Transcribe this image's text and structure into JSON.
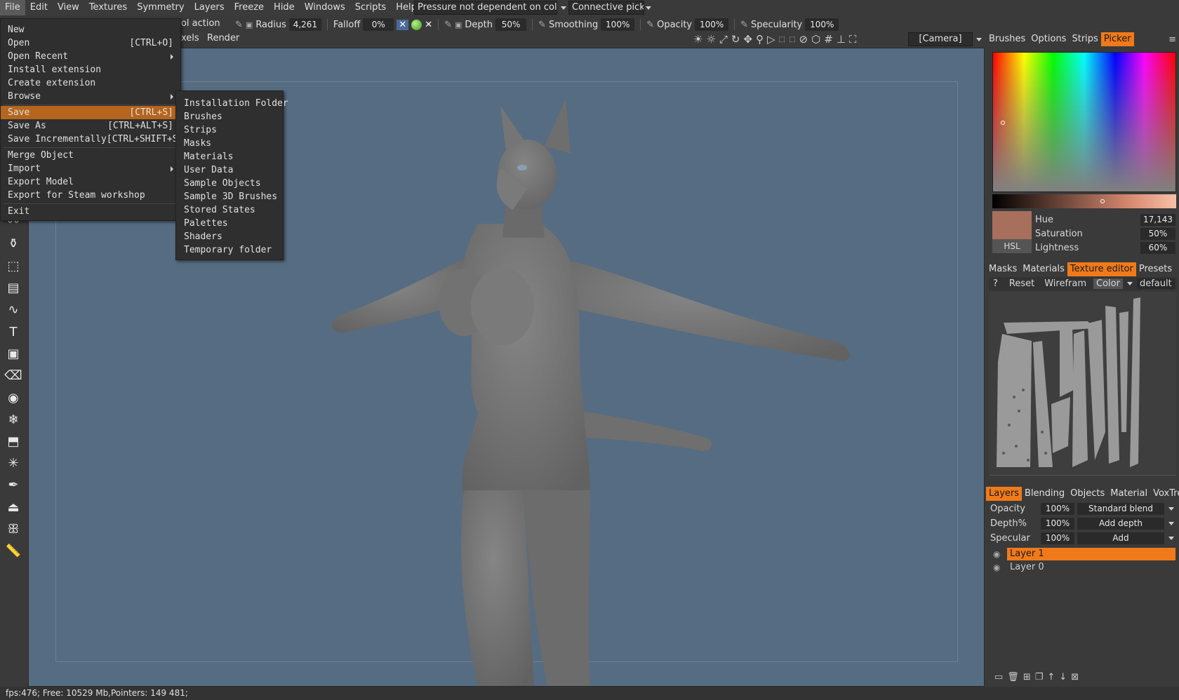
{
  "menubar": {
    "items": [
      "File",
      "Edit",
      "View",
      "Textures",
      "Symmetry",
      "Layers",
      "Freeze",
      "Hide",
      "Windows",
      "Scripts",
      "Help"
    ],
    "pressure_combo": "Pressure not dependent on colo",
    "picking_combo": "Connective picki"
  },
  "toolbar": {
    "tool_action_fragment": "ool action",
    "radius_label": "Radius",
    "radius_value": "4,261",
    "falloff_label": "Falloff",
    "falloff_value": "0%",
    "depth_label": "Depth",
    "depth_value": "50%",
    "smoothing_label": "Smoothing",
    "smoothing_value": "100%",
    "opacity_label": "Opacity",
    "opacity_value": "100%",
    "specularity_label": "Specularity",
    "specularity_value": "100%",
    "camera_combo": "[Camera]",
    "sub_tabs": [
      "xels",
      "Render"
    ]
  },
  "file_menu": {
    "items": [
      {
        "label": "New",
        "shortcut": ""
      },
      {
        "label": "Open",
        "shortcut": "[CTRL+O]"
      },
      {
        "label": "Open Recent",
        "shortcut": ""
      },
      {
        "label": "Install extension",
        "shortcut": ""
      },
      {
        "label": "Create extension",
        "shortcut": ""
      },
      {
        "label": "Browse",
        "shortcut": ""
      },
      {
        "label": "Save",
        "shortcut": "[CTRL+S]"
      },
      {
        "label": "Save As",
        "shortcut": "[CTRL+ALT+S]"
      },
      {
        "label": "Save Incrementally",
        "shortcut": "[CTRL+SHIFT+S]"
      },
      {
        "label": "Merge Object",
        "shortcut": ""
      },
      {
        "label": "Import",
        "shortcut": ""
      },
      {
        "label": "Export Model",
        "shortcut": ""
      },
      {
        "label": "Export for Steam workshop",
        "shortcut": ""
      },
      {
        "label": "Exit",
        "shortcut": ""
      }
    ]
  },
  "browse_submenu": {
    "items": [
      "Installation Folder",
      "Brushes",
      "Strips",
      "Masks",
      "Materials",
      "User Data",
      "Sample Objects",
      "Sample 3D Brushes",
      "Stored States",
      "Palettes",
      "Shaders",
      "Temporary folder"
    ]
  },
  "right_panel": {
    "top_tabs": [
      "Brushes",
      "Options",
      "Strips",
      "Picker"
    ],
    "top_active": "Picker",
    "color_mode": "HSL",
    "hue_label": "Hue",
    "hue_value": "17,143",
    "saturation_label": "Saturation",
    "saturation_value": "50%",
    "lightness_label": "Lightness",
    "lightness_value": "60%",
    "current_color": "#a86f5d",
    "mid_tabs": [
      "Masks",
      "Materials",
      "Texture editor",
      "Presets"
    ],
    "mid_active": "Texture editor",
    "tex_toolbar": {
      "help": "?",
      "reset": "Reset",
      "wireframe": "Wirefram",
      "color": "Color",
      "preset": "default"
    },
    "layer_tabs": [
      "Layers",
      "Blending",
      "Objects",
      "Material",
      "VoxTree"
    ],
    "layer_active": "Layers",
    "layer_opacity_label": "Opacity",
    "layer_opacity_value": "100%",
    "layer_opacity_mode": "Standard blend",
    "layer_depth_label": "Depth%",
    "layer_depth_value": "100%",
    "layer_depth_mode": "Add depth",
    "layer_specular_label": "Specular",
    "layer_specular_value": "100%",
    "layer_specular_mode": "Add",
    "layers": [
      {
        "name": "Layer 1",
        "selected": true
      },
      {
        "name": "Layer 0",
        "selected": false
      }
    ]
  },
  "statusbar": {
    "text": "fps:476;   Free: 10529 Mb,Pointers: 149  481;"
  },
  "colors": {
    "accent": "#f07a1a",
    "menu_highlight": "#b5651d",
    "viewport": "#566c82",
    "model": "#777777"
  }
}
